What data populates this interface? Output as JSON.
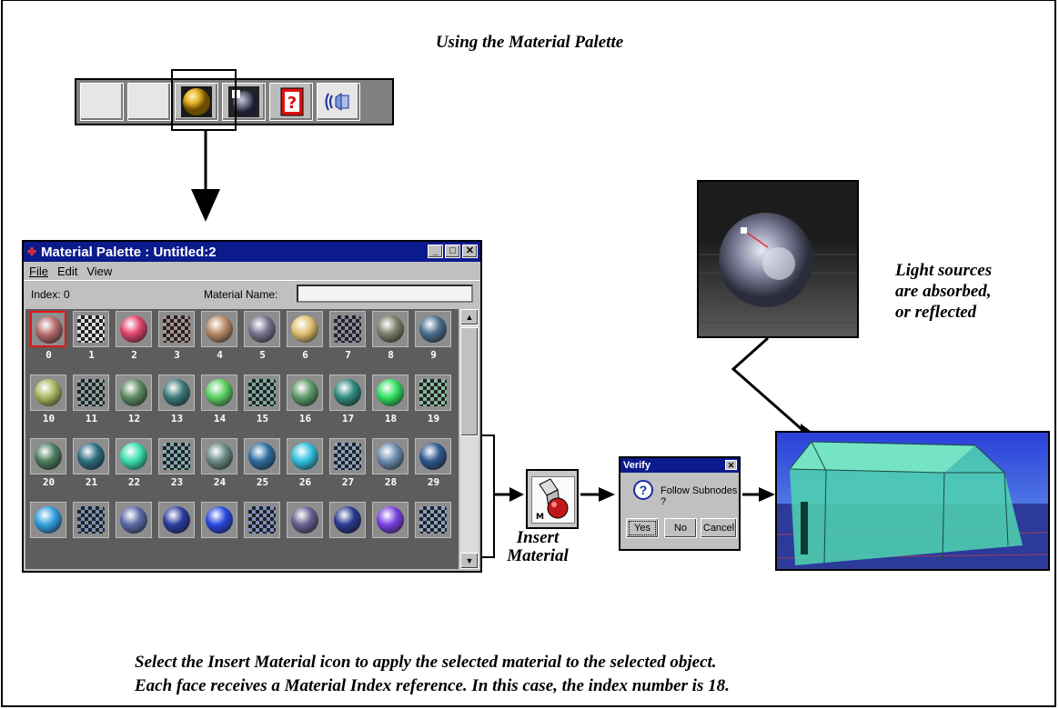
{
  "title": "Using the Material Palette",
  "toolbar": {
    "buttons": [
      "blank-button",
      "blank-button",
      "material-palette-sphere-icon",
      "light-source-icon",
      "help-card-icon",
      "sound-icon"
    ]
  },
  "palette": {
    "window_title": "Material Palette : Untitled:2",
    "window_buttons": [
      "_",
      "□",
      "✕"
    ],
    "menu": {
      "file": "File",
      "edit": "Edit",
      "view": "View"
    },
    "index_label": "Index: 0",
    "material_name_label": "Material Name:",
    "material_name_value": "",
    "selected_index": 0,
    "materials": [
      {
        "n": "0",
        "c": "#b56a6a",
        "checker": false
      },
      {
        "n": "1",
        "c": "#dddddd",
        "checker": true
      },
      {
        "n": "2",
        "c": "#e0456e",
        "checker": false
      },
      {
        "n": "3",
        "c": "#a89090",
        "checker": true
      },
      {
        "n": "4",
        "c": "#b88a66",
        "checker": false
      },
      {
        "n": "5",
        "c": "#7a728f",
        "checker": false
      },
      {
        "n": "6",
        "c": "#e0c070",
        "checker": false
      },
      {
        "n": "7",
        "c": "#8a8aa0",
        "checker": true
      },
      {
        "n": "8",
        "c": "#7d8068",
        "checker": false
      },
      {
        "n": "9",
        "c": "#4a6e8c",
        "checker": false
      },
      {
        "n": "10",
        "c": "#a8b860",
        "checker": false
      },
      {
        "n": "11",
        "c": "#8aa0a0",
        "checker": true
      },
      {
        "n": "12",
        "c": "#5f8a5f",
        "checker": false
      },
      {
        "n": "13",
        "c": "#3c7a7a",
        "checker": false
      },
      {
        "n": "14",
        "c": "#5ad060",
        "checker": false
      },
      {
        "n": "15",
        "c": "#7ea8a0",
        "checker": true
      },
      {
        "n": "16",
        "c": "#5e9a68",
        "checker": false
      },
      {
        "n": "17",
        "c": "#2f8a80",
        "checker": false
      },
      {
        "n": "18",
        "c": "#30e060",
        "checker": false
      },
      {
        "n": "19",
        "c": "#8ab8a0",
        "checker": true
      },
      {
        "n": "20",
        "c": "#4c7e60",
        "checker": false
      },
      {
        "n": "21",
        "c": "#2e6e80",
        "checker": false
      },
      {
        "n": "22",
        "c": "#3ae0b0",
        "checker": false
      },
      {
        "n": "23",
        "c": "#80a8b0",
        "checker": true
      },
      {
        "n": "24",
        "c": "#6a8a86",
        "checker": false
      },
      {
        "n": "25",
        "c": "#2f6ea0",
        "checker": false
      },
      {
        "n": "26",
        "c": "#30c0e0",
        "checker": false
      },
      {
        "n": "27",
        "c": "#8aa0c0",
        "checker": true
      },
      {
        "n": "28",
        "c": "#6c8cb0",
        "checker": false
      },
      {
        "n": "29",
        "c": "#2f5890",
        "checker": false
      },
      {
        "n": "",
        "c": "#30a0e0",
        "checker": false
      },
      {
        "n": "",
        "c": "#7890b0",
        "checker": true
      },
      {
        "n": "",
        "c": "#5a6aa8",
        "checker": false
      },
      {
        "n": "",
        "c": "#2a3ea0",
        "checker": false
      },
      {
        "n": "",
        "c": "#2848e0",
        "checker": false
      },
      {
        "n": "",
        "c": "#8090c0",
        "checker": true
      },
      {
        "n": "",
        "c": "#6a6090",
        "checker": false
      },
      {
        "n": "",
        "c": "#2a3a90",
        "checker": false
      },
      {
        "n": "",
        "c": "#7a40e0",
        "checker": false
      },
      {
        "n": "",
        "c": "#8aa0c0",
        "checker": true
      }
    ]
  },
  "insert_material": {
    "label_line1": "Insert",
    "label_line2": "Material"
  },
  "verify_dialog": {
    "title": "Verify",
    "message": "Follow Subnodes ?",
    "yes": "Yes",
    "no": "No",
    "cancel": "Cancel"
  },
  "light_caption": {
    "line1": "Light sources",
    "line2": "are absorbed,",
    "line3": "or reflected"
  },
  "bottom_caption": {
    "line1": "Select the Insert Material icon to apply the selected material to the selected object.",
    "line2": "Each face receives a Material Index reference. In this case, the index number is 18."
  },
  "colors": {
    "title_bar": "#0b1a8c",
    "selection": "#e21515",
    "house_glass": "#4fd6b0"
  }
}
